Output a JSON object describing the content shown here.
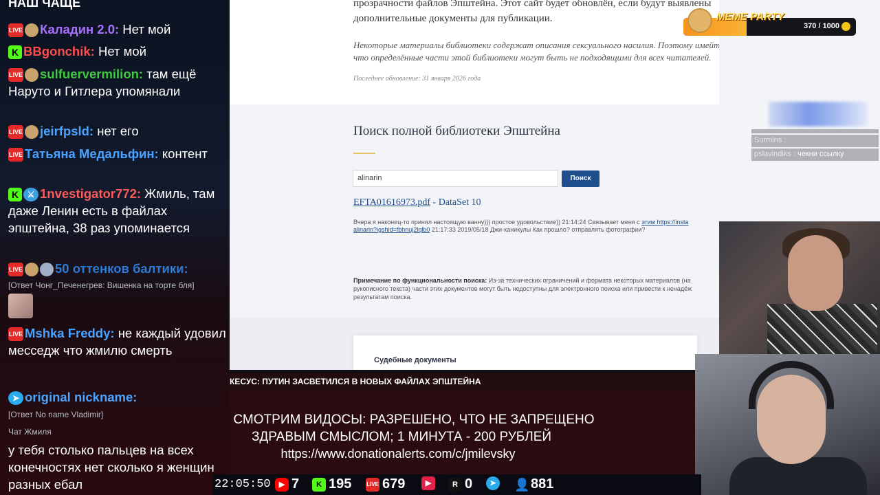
{
  "chat": {
    "header": "НАШ ЧАЩЕ",
    "messages": [
      {
        "nick": "Каладин 2.0:",
        "nick_color": "#a970ff",
        "text": " Нет мой"
      },
      {
        "nick": "BBgonchik:",
        "nick_color": "#ff4d4d",
        "text": " Нет мой"
      },
      {
        "nick": "sulfuervermilion:",
        "nick_color": "#3fc93f",
        "text": " там ещё Наруто и Гитлера упомянали"
      },
      {
        "nick": "jeirfpsld:",
        "nick_color": "#4aa3ff",
        "text": " нет его"
      },
      {
        "nick": "Татьяна Медальфин:",
        "nick_color": "#4aa3ff",
        "text": " контент"
      },
      {
        "nick": "1nvestigator772:",
        "nick_color": "#ff5a5a",
        "text": " Жмиль, там даже Ленин есть в файлах эпштейна, 38 раз упоминается"
      },
      {
        "nick": "50 оттенков балтики:",
        "nick_color": "#2e7bd6",
        "text": ""
      },
      {
        "nick": "Mshka Freddy:",
        "nick_color": "#4aa3ff",
        "text": " не каждый удовил месседж что жмилю смерть"
      },
      {
        "nick": "original nickname:",
        "nick_color": "#4aa3ff",
        "text": ""
      }
    ],
    "replies": [
      "[Ответ Чонг_Печенегрев: Вишенка на торте бля]",
      "[Ответ No name Vladimir]",
      "Чат Жмиля"
    ],
    "last_message": "у тебя столько пальцев на всех конечностях нет сколько я женщин разных ебал"
  },
  "page": {
    "intro": "прозрачности файлов Эпштейна. Этот сайт будет обновлён, если будут выявлены дополнительные документы для публикации.",
    "warning": "Некоторые материалы библиотеки содержат описания сексуального насилия. Поэтому имейте в виду, что определённые части этой библиотеки могут быть не подходящими для всех читателей.",
    "updated_label": "Последнее обновление:",
    "updated_date": "31 января 2026 года",
    "search_title": "Поиск полной библиотеки Эпштейна",
    "search_value": "alinarin",
    "search_button": "Поиск",
    "result_link": "EFTA01616973.pdf",
    "result_dataset": " - DataSet 10",
    "snippet_line1": "Вчера я наконец-то принял настоящую ванну))) простое удовольствие)) 21:14:24 Связывает меня с ",
    "snippet_link1": "этим https://insta",
    "snippet_link2": "alinarin?igshid=fbhnuj2lqlb0",
    "snippet_line2": " 21:17:33 2019/05/18 Джи-каникулы Как прошло? отправлять фотографии?",
    "note_label": "Примечание по функциональности поиска:",
    "note_text": " Из-за технических ограничений и формата некоторых материалов (на рукописного текста) части этих документов могут быть недоступны для электронного поиска или привести к ненадёж результатам поиска.",
    "card_title": "Судебные документы"
  },
  "meme_party": {
    "title": "MEME PARTY",
    "count": "370 / 1000"
  },
  "mini_chat": [
    {
      "nick": "Surmins :",
      "text": ""
    },
    {
      "nick": "pslavindiks :",
      "text": " чекни ссылку"
    }
  ],
  "ticker": "КЕСУС: ПУТИН ЗАСВЕТИЛСЯ В НОВЫХ ФАЙЛАХ ЭПШТЕЙНА",
  "rules": {
    "line1": "СМОТРИМ ВИДОСЫ: РАЗРЕШЕНО, ЧТО НЕ ЗАПРЕЩЕНО",
    "line2": "ЗДРАВЫМ СМЫСЛОМ; 1 МИНУТА - 200 РУБЛЕЙ",
    "line3": "https://www.donationalerts.com/c/jmilevsky"
  },
  "status": {
    "time": "22:05:50",
    "youtube": "7",
    "kick": "195",
    "vk_live": "679",
    "rutube": "",
    "r": "0",
    "viewers": "881"
  },
  "colors": {
    "youtube": "#ff0000",
    "kick": "#53fc18",
    "vk_live": "#e52a2a",
    "rutube": "#e5204a",
    "telegram": "#2aabee",
    "viewers": "#4aa3ff"
  }
}
